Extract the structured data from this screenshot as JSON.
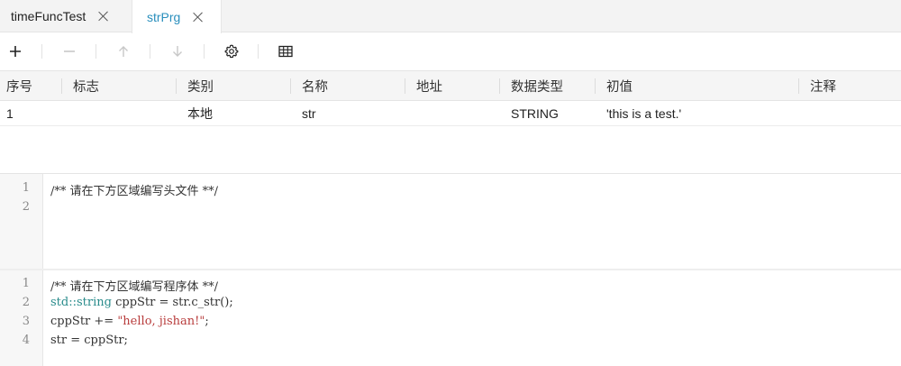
{
  "tabs": [
    {
      "label": "timeFuncTest",
      "active": false
    },
    {
      "label": "strPrg",
      "active": true
    }
  ],
  "toolbar": {
    "icons": [
      "plus-icon",
      "minus-icon",
      "arrow-up-icon",
      "arrow-down-icon",
      "gear-icon",
      "table-icon"
    ]
  },
  "table": {
    "headers": [
      "序号",
      "标志",
      "类别",
      "名称",
      "地址",
      "数据类型",
      "初值",
      "注释"
    ],
    "rows": [
      [
        "1",
        "",
        "本地",
        "str",
        "",
        "STRING",
        "'this is a test.'",
        ""
      ]
    ]
  },
  "header_editor": {
    "lines": [
      "1",
      "2"
    ],
    "comment": "/** 请在下方区域编写头文件 **/"
  },
  "body_editor": {
    "lines": [
      "1",
      "2",
      "3",
      "4"
    ],
    "comment": "/** 请在下方区域编写程序体 **/",
    "line2_type": "std::string",
    "line2_rest": " cppStr = str.c_str();",
    "line3_pre": "cppStr += ",
    "line3_str": "\"hello, jishan!\"",
    "line3_post": ";",
    "line4": "str = cppStr;"
  },
  "colors": {
    "active_tab": "#2a8fbd",
    "comment": "#a0522d",
    "type": "#2a8c8c",
    "string": "#b83c3c"
  }
}
